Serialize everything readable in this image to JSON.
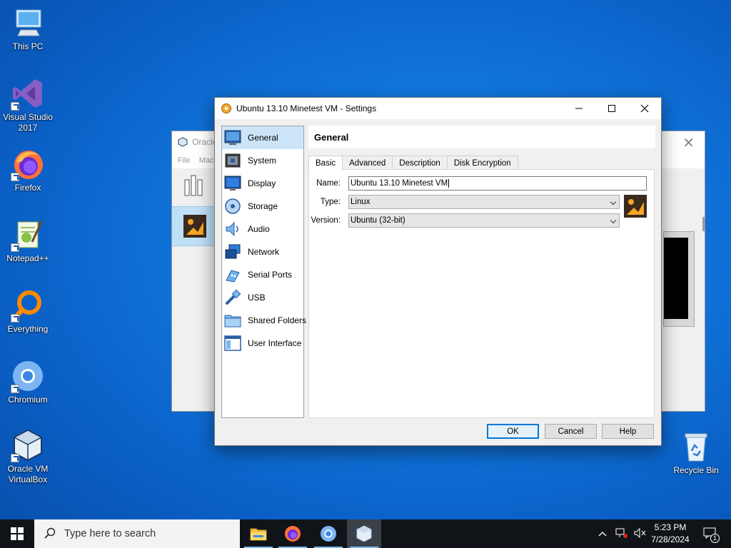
{
  "desktop": {
    "icons": [
      {
        "label": "This PC"
      },
      {
        "label": "Visual Studio 2017"
      },
      {
        "label": "Firefox"
      },
      {
        "label": "Notepad++"
      },
      {
        "label": "Everything"
      },
      {
        "label": "Chromium"
      },
      {
        "label": "Oracle VM VirtualBox"
      },
      {
        "label": "Recycle Bin"
      }
    ]
  },
  "manager": {
    "title": "Oracle",
    "menu": [
      "File",
      "Mach"
    ]
  },
  "dialog": {
    "title": "Ubuntu 13.10 Minetest VM - Settings",
    "nav": [
      {
        "label": "General",
        "icon": "general-icon",
        "selected": true
      },
      {
        "label": "System",
        "icon": "system-icon"
      },
      {
        "label": "Display",
        "icon": "display-icon"
      },
      {
        "label": "Storage",
        "icon": "storage-icon"
      },
      {
        "label": "Audio",
        "icon": "audio-icon"
      },
      {
        "label": "Network",
        "icon": "network-icon"
      },
      {
        "label": "Serial Ports",
        "icon": "serial-ports-icon"
      },
      {
        "label": "USB",
        "icon": "usb-icon"
      },
      {
        "label": "Shared Folders",
        "icon": "shared-folders-icon"
      },
      {
        "label": "User Interface",
        "icon": "user-interface-icon"
      }
    ],
    "section_title": "General",
    "tabs": [
      "Basic",
      "Advanced",
      "Description",
      "Disk Encryption"
    ],
    "active_tab": "Basic",
    "fields": {
      "name_label": "Name:",
      "name_value": "Ubuntu 13.10 Minetest VM",
      "type_label": "Type:",
      "type_value": "Linux",
      "version_label": "Version:",
      "version_value": "Ubuntu (32-bit)"
    },
    "buttons": {
      "ok": "OK",
      "cancel": "Cancel",
      "help": "Help"
    }
  },
  "taskbar": {
    "search_placeholder": "Type here to search",
    "apps": [
      "file-explorer-icon",
      "firefox-icon",
      "chromium-icon",
      "virtualbox-icon"
    ],
    "time": "5:23 PM",
    "date": "7/28/2024",
    "notification_count": "1"
  },
  "colors": {
    "accent": "#0078d7",
    "selection": "#cce4f7",
    "desktop": "#1177dd"
  }
}
